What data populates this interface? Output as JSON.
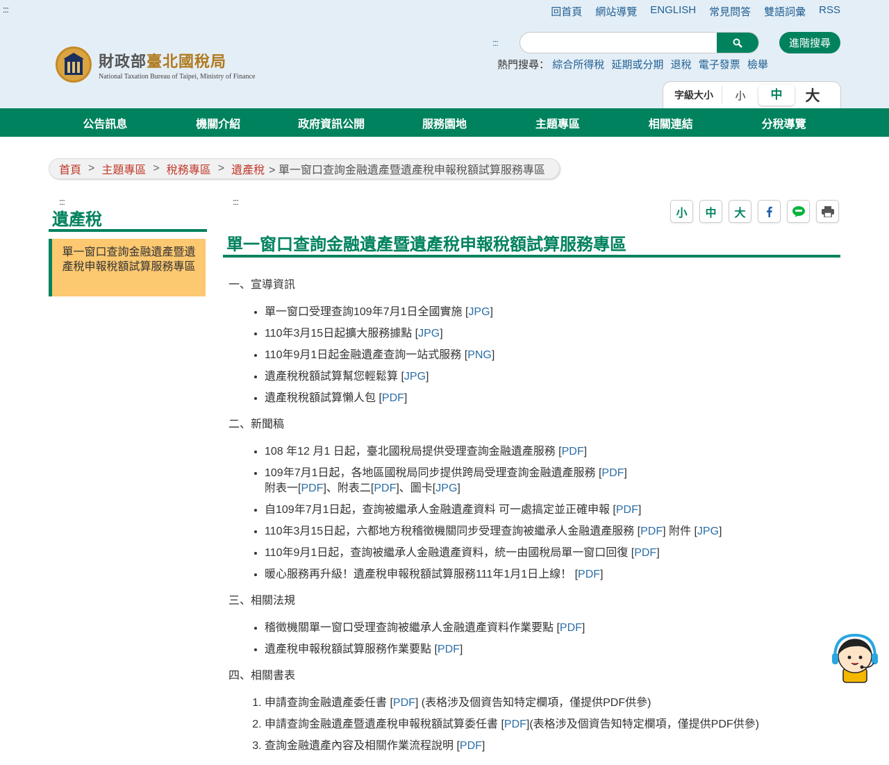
{
  "header": {
    "accesskey_top": ":::",
    "top_links": [
      "回首頁",
      "網站導覽",
      "ENGLISH",
      "常見問答",
      "雙語詞彙",
      "RSS"
    ],
    "logo": {
      "name_a": "財政部",
      "name_b": "臺北國稅局",
      "name_en": "National Taxation Bureau of Taipei, Ministry of Finance"
    },
    "accesskey_search": ":::",
    "search": {
      "placeholder": "",
      "advanced_label": "進階搜尋"
    },
    "hot_search": {
      "label": "熱門搜尋：",
      "items": [
        "綜合所得稅",
        "延期或分期",
        "退稅",
        "電子發票",
        "檢舉"
      ]
    },
    "font_size": {
      "label": "字級大小",
      "small": "小",
      "medium": "中",
      "large": "大"
    }
  },
  "nav": [
    "公告訊息",
    "機關介紹",
    "政府資訊公開",
    "服務園地",
    "主題專區",
    "相關連結",
    "分稅導覽"
  ],
  "breadcrumb": {
    "items": [
      "首頁",
      "主題專區",
      "稅務專區",
      "遺產稅"
    ],
    "separator": ">",
    "current": "> 單一窗口查詢金融遺產暨遺產稅申報稅額試算服務專區"
  },
  "sidebar": {
    "accesskey": ":::",
    "title": "遺產稅",
    "item": "單一窗口查詢金融遺產暨遺產稅申報稅額試算服務專區"
  },
  "main": {
    "accesskey": ":::",
    "tools": {
      "small": "小",
      "medium": "中",
      "large": "大"
    },
    "title": "單一窗口查詢金融遺產暨遺產稅申報稅額試算服務專區",
    "section1": {
      "heading": "一、宣導資訊",
      "items": [
        {
          "text": "單一窗口受理查詢109年7月1日全國實施 [",
          "link": "JPG",
          "after": "]"
        },
        {
          "text": "110年3月15日起擴大服務據點 [",
          "link": "JPG",
          "after": "]"
        },
        {
          "text": "110年9月1日起金融遺產查詢一站式服務 [",
          "link": "PNG",
          "after": "]"
        },
        {
          "text": "遺產稅稅額試算幫您輕鬆算 [",
          "link": "JPG",
          "after": "]"
        },
        {
          "text": "遺產稅稅額試算懶人包 [",
          "link": "PDF",
          "after": "]"
        }
      ]
    },
    "section2": {
      "heading": "二、新聞稿",
      "item1": {
        "text": "108 年12 月1 日起，臺北國稅局提供受理查詢金融遺產服務 [",
        "link": "PDF",
        "after": "]"
      },
      "item2": {
        "text": "109年7月1日起，各地區國稅局同步提供跨局受理查詢金融遺產服務 [",
        "link": "PDF",
        "after": "]",
        "line2_a": "附表一[",
        "line2_link1": "PDF",
        "line2_b": "]、附表二[",
        "line2_link2": "PDF",
        "line2_c": "]、圖卡[",
        "line2_link3": "JPG",
        "line2_d": "]"
      },
      "item3": {
        "text": "自109年7月1日起，查詢被繼承人金融遺產資料 可一處搞定並正確申報 [",
        "link": "PDF",
        "after": "]"
      },
      "item4": {
        "text": "110年3月15日起，六都地方稅稽徵機關同步受理查詢被繼承人金融遺產服務 [",
        "link": "PDF",
        "mid": "] 附件 [",
        "link2": "JPG",
        "after": "]"
      },
      "item5": {
        "text": "110年9月1日起，查詢被繼承人金融遺產資料，統一由國稅局單一窗口回復 [",
        "link": "PDF",
        "after": "]"
      },
      "item6": {
        "text": "暖心服務再升級！遺產稅申報稅額試算服務111年1月1日上線！ [",
        "link": "PDF",
        "after": "]"
      }
    },
    "section3": {
      "heading": "三、相關法規",
      "items": [
        {
          "text": "稽徵機關單一窗口受理查詢被繼承人金融遺產資料作業要點 [",
          "link": "PDF",
          "after": "]"
        },
        {
          "text": "遺產稅申報稅額試算服務作業要點 [",
          "link": "PDF",
          "after": "]"
        }
      ]
    },
    "section4": {
      "heading": "四、相關書表",
      "items": [
        {
          "text": "申請查詢金融遺產委任書 [",
          "link": "PDF",
          "after": "] (表格涉及個資告知特定欄項，僅提供PDF供參)"
        },
        {
          "text": "申請查詢金融遺產暨遺產稅申報稅額試算委任書 [",
          "link": "PDF",
          "after": "](表格涉及個資告知特定欄項，僅提供PDF供參)"
        },
        {
          "text": "查詢金融遺產內容及相關作業流程說明 [",
          "link": "PDF",
          "after": "]"
        }
      ]
    }
  },
  "colors": {
    "primary": "#00825e",
    "header_bg": "#e4eef6",
    "sidebar_item_bg": "#fcc870",
    "link": "#2a6ea8",
    "breadcrumb_link": "#c0392b"
  }
}
